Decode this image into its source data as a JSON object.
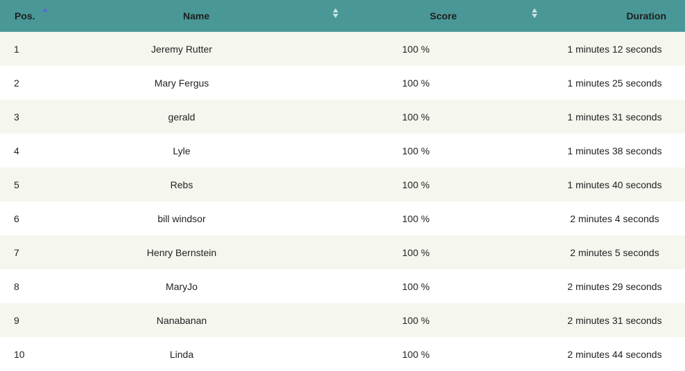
{
  "table": {
    "headers": {
      "pos": "Pos.",
      "name": "Name",
      "score": "Score",
      "duration": "Duration"
    },
    "sort": {
      "active_column": "pos",
      "direction": "ascending",
      "active_color": "#5a6ad0",
      "inactive_color": "#c9e3e3"
    },
    "header_background": "#4a9797",
    "row_stripe_color": "#f5f6ee",
    "rows": [
      {
        "pos": "1",
        "name": "Jeremy Rutter",
        "score": "100 %",
        "duration": "1 minutes 12 seconds"
      },
      {
        "pos": "2",
        "name": "Mary Fergus",
        "score": "100 %",
        "duration": "1 minutes 25 seconds"
      },
      {
        "pos": "3",
        "name": "gerald",
        "score": "100 %",
        "duration": "1 minutes 31 seconds"
      },
      {
        "pos": "4",
        "name": "Lyle",
        "score": "100 %",
        "duration": "1 minutes 38 seconds"
      },
      {
        "pos": "5",
        "name": "Rebs",
        "score": "100 %",
        "duration": "1 minutes 40 seconds"
      },
      {
        "pos": "6",
        "name": "bill windsor",
        "score": "100 %",
        "duration": "2 minutes 4 seconds"
      },
      {
        "pos": "7",
        "name": "Henry Bernstein",
        "score": "100 %",
        "duration": "2 minutes 5 seconds"
      },
      {
        "pos": "8",
        "name": "MaryJo",
        "score": "100 %",
        "duration": "2 minutes 29 seconds"
      },
      {
        "pos": "9",
        "name": "Nanabanan",
        "score": "100 %",
        "duration": "2 minutes 31 seconds"
      },
      {
        "pos": "10",
        "name": "Linda",
        "score": "100 %",
        "duration": "2 minutes 44 seconds"
      }
    ]
  }
}
